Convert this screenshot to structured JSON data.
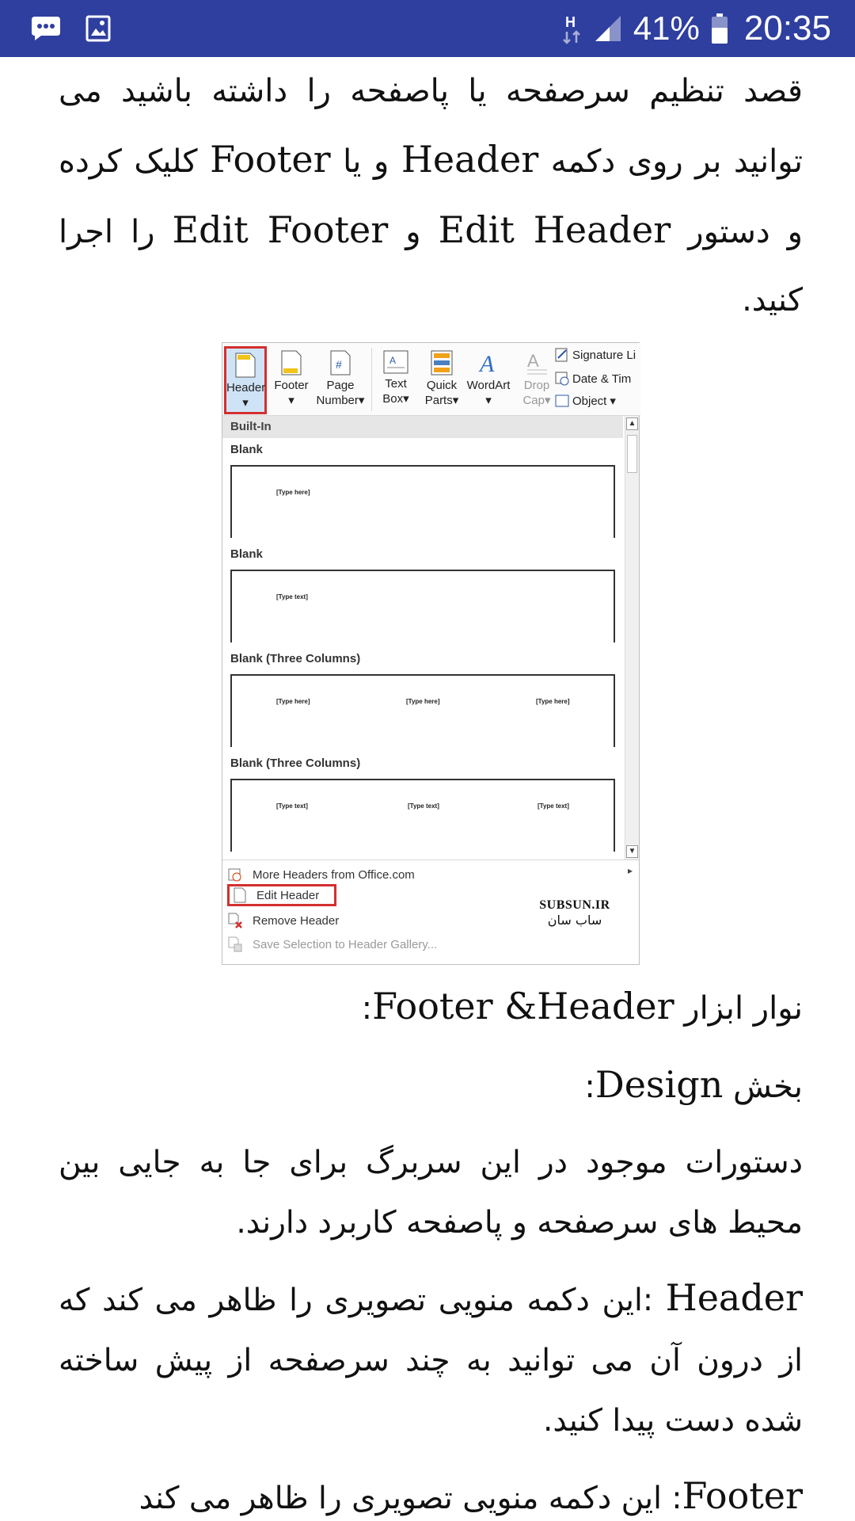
{
  "status_bar": {
    "battery_percent": "41%",
    "time": "20:35",
    "network_label": "H",
    "icons": [
      "messages-icon",
      "gallery-icon",
      "data-arrows-icon",
      "signal-icon",
      "battery-icon"
    ]
  },
  "article": {
    "p1": [
      {
        "t": "قصد تنظیم سرصفحه یا پاصفحه را داشته باشید می توانید بر روی دکمه ",
        "latin": false
      },
      {
        "t": "Header",
        "latin": true
      },
      {
        "t": " و یا ",
        "latin": false
      },
      {
        "t": "Footer",
        "latin": true
      },
      {
        "t": " کلیک کرده و دستور ",
        "latin": false
      },
      {
        "t": "Edit Header",
        "latin": true
      },
      {
        "t": " و ",
        "latin": false
      },
      {
        "t": "Edit Footer",
        "latin": true
      },
      {
        "t": " را اجرا کنید.",
        "latin": false
      }
    ],
    "heading1_prefix": "نوار ابزار ",
    "heading1_latin": "Footer &Header",
    "heading1_suffix": ":",
    "heading2_prefix": "بخش ",
    "heading2_latin": "Design",
    "heading2_suffix": ":",
    "p2": "دستورات موجود در این سربرگ برای جا به جایی بین محیط های سرصفحه و پاصفحه کاربرد دارند.",
    "p3_latin": "Header",
    "p3_text": " :این دکمه منویی تصویری را ظاهر می کند که از درون آن می توانید به چند سرصفحه از پیش ساخته شده دست پیدا کنید.",
    "p4_latin": "Footer",
    "p4_text": ": این دکمه منویی تصویری را ظاهر می کند"
  },
  "screenshot": {
    "ribbon": {
      "header": "Header",
      "footer": "Footer",
      "page": "Page",
      "number": "Number",
      "text": "Text",
      "box": "Box",
      "quick": "Quick",
      "parts": "Parts",
      "wordart": "WordArt",
      "drop": "Drop",
      "cap": "Cap",
      "signature": "Signature Li",
      "datetime": "Date & Tim",
      "object": "Object"
    },
    "builtin": "Built-In",
    "items": [
      {
        "title": "Blank",
        "placeholders": [
          "[Type here]"
        ]
      },
      {
        "title": "Blank",
        "placeholders": [
          "[Type text]"
        ]
      },
      {
        "title": "Blank (Three Columns)",
        "placeholders": [
          "[Type here]",
          "[Type here]",
          "[Type here]"
        ]
      },
      {
        "title": "Blank (Three Columns)",
        "placeholders": [
          "[Type text]",
          "[Type text]",
          "[Type text]"
        ]
      }
    ],
    "menu": {
      "more": "More Headers from Office.com",
      "edit": "Edit Header",
      "remove": "Remove Header",
      "save": "Save Selection to Header Gallery..."
    },
    "watermark_l1": "SUBSUN.IR",
    "watermark_l2": "ساب سان"
  }
}
